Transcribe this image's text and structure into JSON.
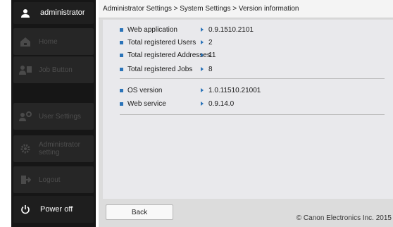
{
  "sidebar": {
    "user": "administrator",
    "items": [
      {
        "label": "Home"
      },
      {
        "label": "Job Button"
      },
      {
        "label": "User Settings"
      },
      {
        "label": "Administrator setting"
      },
      {
        "label": "Logout"
      }
    ],
    "power": "Power off"
  },
  "breadcrumb": "Administrator Settings > System Settings > Version information",
  "info": {
    "group1": [
      {
        "key": "Web application",
        "value": "0.9.1510.2101"
      },
      {
        "key": "Total registered Users",
        "value": "2"
      },
      {
        "key": "Total registered Addresses",
        "value": "11"
      },
      {
        "key": "Total registered Jobs",
        "value": "8"
      }
    ],
    "group2": [
      {
        "key": "OS version",
        "value": "1.0.11510.21001"
      },
      {
        "key": "Web service",
        "value": "0.9.14.0"
      }
    ]
  },
  "footer": {
    "back_label": "Back",
    "copyright": "© Canon Electronics Inc. 2015"
  },
  "colors": {
    "accent": "#2a73b8",
    "sidebar_bg": "#161616",
    "main_bg": "#dcdcdc"
  }
}
